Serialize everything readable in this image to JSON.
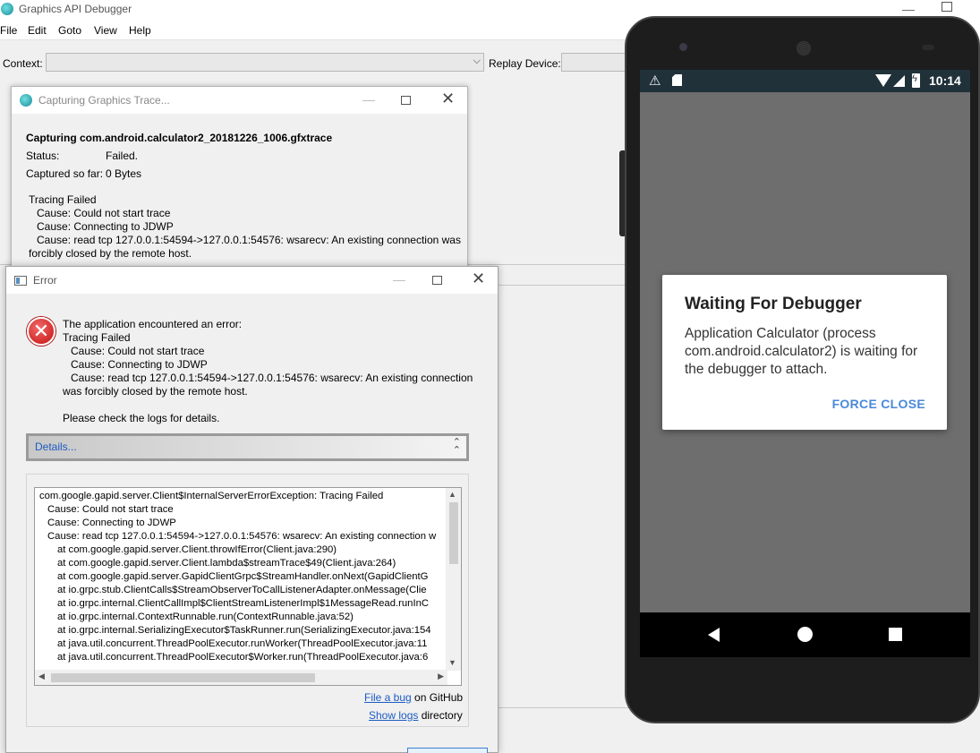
{
  "main_window": {
    "title": "Graphics API Debugger",
    "minimize": "—",
    "menu": [
      "File",
      "Edit",
      "Goto",
      "View",
      "Help"
    ],
    "context_label": "Context:",
    "context_value": "",
    "replay_label": "Replay Device:"
  },
  "capture_dialog": {
    "title": "Capturing Graphics Trace...",
    "file": "Capturing com.android.calculator2_20181226_1006.gfxtrace",
    "status_label": "Status:",
    "status_value": "Failed.",
    "captured_label": "Captured so far:",
    "captured_value": "0 Bytes",
    "errors": [
      "Tracing Failed",
      "Cause: Could not start trace",
      "Cause: Connecting to JDWP",
      "Cause: read tcp 127.0.0.1:54594->127.0.0.1:54576: wsarecv: An existing connection was",
      "forcibly closed by the remote host."
    ]
  },
  "error_dialog": {
    "title": "Error",
    "message": [
      "The application encountered an error:",
      "Tracing Failed",
      "Cause: Could not start trace",
      "Cause: Connecting to JDWP",
      "Cause: read tcp 127.0.0.1:54594->127.0.0.1:54576: wsarecv: An existing connection",
      "was forcibly closed by the remote host.",
      "Please check the logs for details."
    ],
    "details_label": "Details...",
    "stack_trace": [
      "com.google.gapid.server.Client$InternalServerErrorException: Tracing Failed",
      "Cause: Could not start trace",
      "Cause: Connecting to JDWP",
      "Cause: read tcp 127.0.0.1:54594->127.0.0.1:54576: wsarecv: An existing connection w",
      "at com.google.gapid.server.Client.throwIfError(Client.java:290)",
      "at com.google.gapid.server.Client.lambda$streamTrace$49(Client.java:264)",
      "at com.google.gapid.server.GapidClientGrpc$StreamHandler.onNext(GapidClientG",
      "at io.grpc.stub.ClientCalls$StreamObserverToCallListenerAdapter.onMessage(Clie",
      "at io.grpc.internal.ClientCallImpl$ClientStreamListenerImpl$1MessageRead.runInC",
      "at io.grpc.internal.ContextRunnable.run(ContextRunnable.java:52)",
      "at io.grpc.internal.SerializingExecutor$TaskRunner.run(SerializingExecutor.java:154",
      "at java.util.concurrent.ThreadPoolExecutor.runWorker(ThreadPoolExecutor.java:11",
      "at java.util.concurrent.ThreadPoolExecutor$Worker.run(ThreadPoolExecutor.java:6"
    ],
    "file_bug_link": "File a bug",
    "file_bug_suffix": " on GitHub",
    "show_logs_link": "Show logs",
    "show_logs_suffix": " directory"
  },
  "phone": {
    "status_time": "10:14",
    "dialog_title": "Waiting For Debugger",
    "dialog_body": "Application Calculator (process com.android.calculator2) is waiting for the debugger to attach.",
    "force_close": "FORCE CLOSE",
    "colors": {
      "statusbar": "#20313a",
      "accent": "#4a8ad8",
      "screen": "#6e6e6e"
    }
  },
  "icons": {
    "warning": "⚠",
    "error": "✕",
    "chevron_down": "⌵",
    "collapse": "⌃",
    "close": "✕"
  }
}
